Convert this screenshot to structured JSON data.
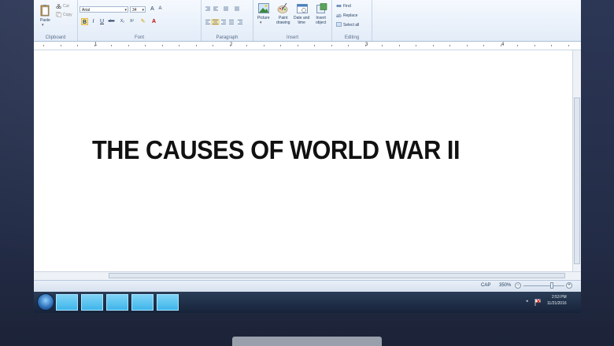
{
  "ribbon": {
    "clipboard": {
      "paste_label": "Paste",
      "cut_label": "Cut",
      "copy_label": "Copy",
      "group_label": "Clipboard"
    },
    "font": {
      "font_name": "Arial",
      "font_size": "34",
      "group_label": "Font"
    },
    "paragraph": {
      "group_label": "Paragraph"
    },
    "insert": {
      "picture_label": "Picture",
      "paint_label": "Paint\ndrawing",
      "datetime_label": "Date and\ntime",
      "object_label": "Insert\nobject",
      "group_label": "Insert"
    },
    "editing": {
      "find_label": "Find",
      "replace_label": "Replace",
      "select_all_label": "Select all",
      "group_label": "Editing"
    }
  },
  "ruler": {
    "numbers": [
      "1",
      "2",
      "3",
      "4"
    ]
  },
  "document": {
    "text": "THE CAUSES OF WORLD WAR II"
  },
  "statusbar": {
    "caps": "CAP",
    "zoom": "350%"
  },
  "taskbar": {
    "time": "2:53 PM",
    "date": "11/21/2016"
  },
  "colors": {
    "ribbon_bg": "#e3ecf8",
    "taskbar_bg": "#1e2c44",
    "bezel": "#26304a",
    "taskbar_button": "#4fc0ef"
  },
  "icons": [
    "paste-icon",
    "cut-icon",
    "copy-icon",
    "bold-icon",
    "italic-icon",
    "picture-icon",
    "paint-icon",
    "datetime-icon",
    "object-icon",
    "find-icon",
    "replace-icon",
    "select-all-icon",
    "windows-start-icon",
    "flag-icon"
  ]
}
